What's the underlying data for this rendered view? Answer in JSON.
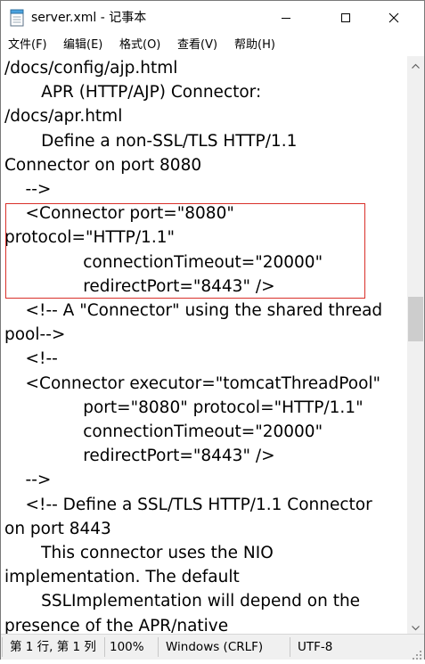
{
  "window": {
    "title": "server.xml - 记事本",
    "icons": [
      "notepad-icon",
      "minimize-icon",
      "maximize-icon",
      "close-icon"
    ]
  },
  "menu": {
    "file": "文件(F)",
    "edit": "编辑(E)",
    "format": "格式(O)",
    "view": "查看(V)",
    "help": "帮助(H)"
  },
  "editor": {
    "content": "/docs/config/ajp.html\n       APR (HTTP/AJP) Connector:\n/docs/apr.html\n       Define a non-SSL/TLS HTTP/1.1\nConnector on port 8080\n    -->\n    <Connector port=\"8080\"\nprotocol=\"HTTP/1.1\"\n               connectionTimeout=\"20000\"\n               redirectPort=\"8443\" />\n    <!-- A \"Connector\" using the shared thread\npool-->\n    <!--\n    <Connector executor=\"tomcatThreadPool\"\n               port=\"8080\" protocol=\"HTTP/1.1\"\n               connectionTimeout=\"20000\"\n               redirectPort=\"8443\" />\n    -->\n    <!-- Define a SSL/TLS HTTP/1.1 Connector\non port 8443\n       This connector uses the NIO\nimplementation. The default\n       SSLImplementation will depend on the\npresence of the APR/native",
    "highlight_color": "#d9302a"
  },
  "status": {
    "position": "第 1 行, 第 1 列",
    "zoom": "100%",
    "line_ending": "Windows (CRLF)",
    "encoding": "UTF-8"
  }
}
